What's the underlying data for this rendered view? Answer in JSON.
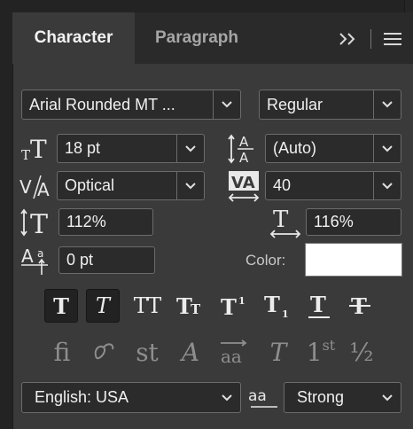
{
  "tabs": {
    "character": "Character",
    "paragraph": "Paragraph"
  },
  "font": {
    "family": "Arial Rounded MT ...",
    "style": "Regular"
  },
  "size": {
    "value": "18 pt"
  },
  "leading": {
    "value": "(Auto)"
  },
  "kerning": {
    "value": "Optical"
  },
  "tracking": {
    "value": "40"
  },
  "vertical_scale": {
    "value": "112%"
  },
  "horizontal_scale": {
    "value": "116%"
  },
  "baseline_shift": {
    "value": "0 pt"
  },
  "color": {
    "label": "Color:",
    "swatch": "#ffffff"
  },
  "language": {
    "value": "English: USA"
  },
  "antialias": {
    "value": "Strong"
  },
  "icons": {
    "faux_bold": "T",
    "faux_italic": "T",
    "all_caps": "TT",
    "small_caps": "TT",
    "superscript": "T",
    "subscript": "T",
    "underline": "T",
    "strikethrough": "T",
    "aa": "aa",
    "fi": "fi",
    "st": "st",
    "A": "A",
    "T": "T",
    "first": "1",
    "first_sup": "st",
    "half": "½"
  }
}
